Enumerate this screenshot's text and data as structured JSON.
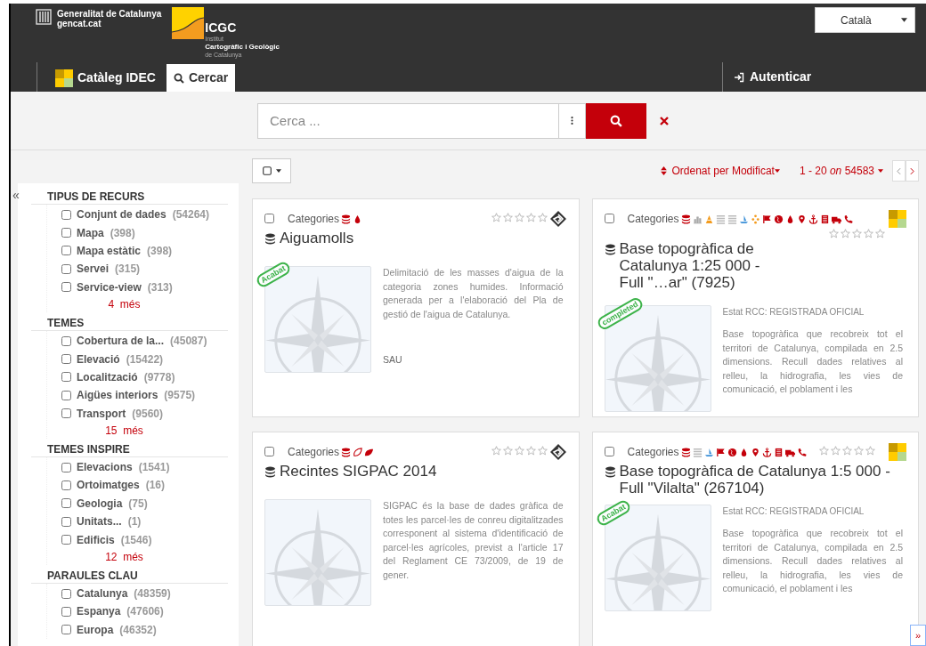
{
  "header": {
    "gov_line1": "Generalitat de Catalunya",
    "gov_line2": "gencat.cat",
    "org_short": "ICGC",
    "org_line1": "Institut",
    "org_line2": "Cartogràfic i Geològic",
    "org_line3": "de Catalunya",
    "language": "Català"
  },
  "nav": {
    "tabs": [
      {
        "label": "Catàleg IDEC",
        "selected": false,
        "kind": "brand"
      },
      {
        "label": "Cercar",
        "selected": true,
        "kind": "search"
      }
    ],
    "login": "Autenticar"
  },
  "search": {
    "placeholder": "Cerca ..."
  },
  "toolbar": {
    "sort": "Ordenat per Modificat",
    "range_start": "1 - 20",
    "range_on": "on",
    "range_total": "54583"
  },
  "sidebar": {
    "collapse": "«",
    "groups": [
      {
        "title": "TIPUS DE RECURS",
        "more_count": "4",
        "more_label": "més",
        "items": [
          {
            "label": "Conjunt de dades",
            "count": "(54264)",
            "checked": false
          },
          {
            "label": "Mapa",
            "count": "(398)",
            "checked": false
          },
          {
            "label": "Mapa estàtic",
            "count": "(398)",
            "checked": false
          },
          {
            "label": "Servei",
            "count": "(315)",
            "checked": false
          },
          {
            "label": "Service-view",
            "count": "(313)",
            "checked": false
          }
        ]
      },
      {
        "title": "TEMES",
        "more_count": "15",
        "more_label": "més",
        "items": [
          {
            "label": "Cobertura de la...",
            "count": "(45087)",
            "checked": false
          },
          {
            "label": "Elevació",
            "count": "(15422)",
            "checked": false
          },
          {
            "label": "Localització",
            "count": "(9778)",
            "checked": false
          },
          {
            "label": "Aigües interiors",
            "count": "(9575)",
            "checked": false
          },
          {
            "label": "Transport",
            "count": "(9560)",
            "checked": false
          }
        ]
      },
      {
        "title": "TEMES INSPIRE",
        "more_count": "12",
        "more_label": "més",
        "items": [
          {
            "label": "Elevacions",
            "count": "(1541)",
            "checked": false
          },
          {
            "label": "Ortoimatges",
            "count": "(16)",
            "checked": false
          },
          {
            "label": "Geologia",
            "count": "(75)",
            "checked": false
          },
          {
            "label": "Unitats...",
            "count": "(1)",
            "checked": false
          },
          {
            "label": "Edificis",
            "count": "(1546)",
            "checked": false
          }
        ]
      },
      {
        "title": "PARAULES CLAU",
        "items": [
          {
            "label": "Catalunya",
            "count": "(48359)",
            "checked": false
          },
          {
            "label": "Espanya",
            "count": "(47606)",
            "checked": false
          },
          {
            "label": "Europa",
            "count": "(46352)",
            "checked": false
          }
        ]
      }
    ]
  },
  "cards": [
    {
      "categories_label": "Categories",
      "kind": "geo",
      "stars": 0,
      "checked": false,
      "title": "Aiguamolls",
      "status_badge": "Acabat",
      "description": "Delimitació de les masses d'aigua de la categoria zones humides. Informació generada per a l'elaboració del Pla de gestió de l'aigua de Catalunya.",
      "footer": "SAU"
    },
    {
      "categories_label": "Categories",
      "kind": "icgc",
      "stars": 0,
      "checked": false,
      "title": "Base topogràfica de Catalunya 1:25 000 - Full \"…ar\" (7925)",
      "status_badge": "completed",
      "rcc_status": "Estat RCC: REGISTRADA OFICIAL",
      "description": "Base topogràfica que recobreix tot el territori de Catalunya, compilada en 2.5 dimensions. Recull dades relatives al relleu, la hidrografia, les vies de comunicació, el poblament i les"
    },
    {
      "categories_label": "Categories",
      "kind": "geo",
      "stars": 0,
      "checked": false,
      "title": "Recintes SIGPAC 2014",
      "description": "SIGPAC és la base de dades gràfica de totes les parcel·les de conreu digitalitzades corresponent al sistema d'identificació de parcel·les agrícoles, previst a l'article 17 del Reglament CE 73/2009, de 19 de gener."
    },
    {
      "categories_label": "Categories",
      "kind": "icgc",
      "stars": 0,
      "checked": false,
      "title": "Base topogràfica de Catalunya 1:5 000 - Full \"Vilalta\" (267104)",
      "status_badge": "Acabat",
      "rcc_status": "Estat RCC: REGISTRADA OFICIAL",
      "description": "Base topogràfica que recobreix tot el territori de Catalunya, compilada en 2.5 dimensions. Recull dades relatives al relleu, la hidrografia, les vies de comunicació, el poblament i les"
    }
  ],
  "expand_panel": "»"
}
